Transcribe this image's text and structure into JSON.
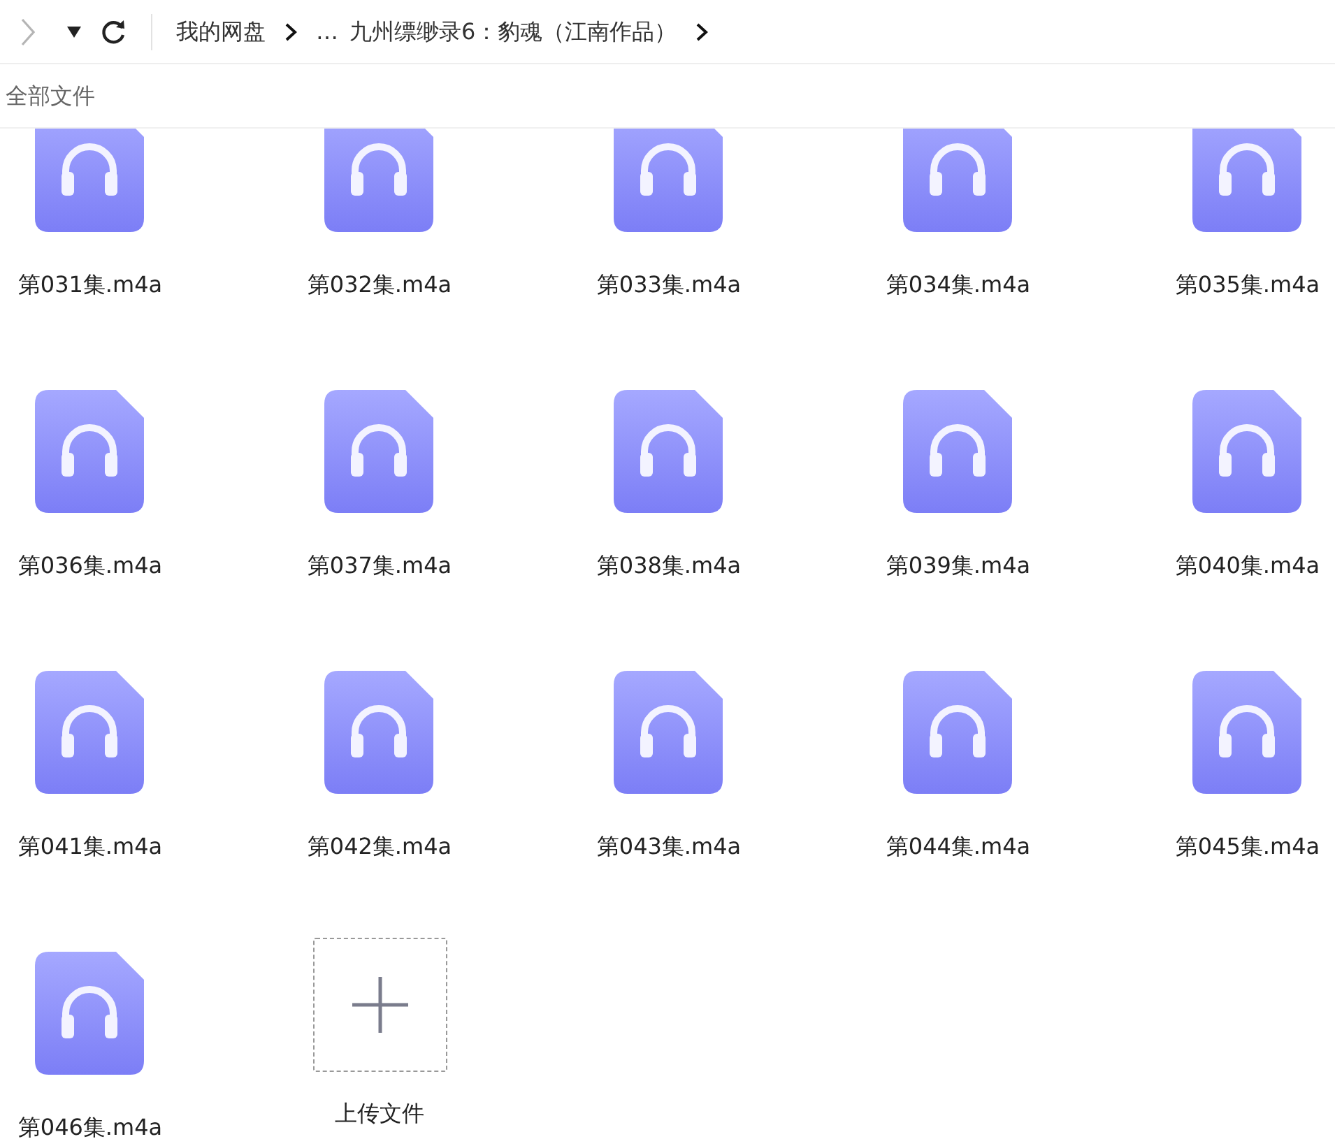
{
  "toolbar": {
    "forward_disabled": true,
    "breadcrumb": [
      {
        "kind": "link",
        "label": "我的网盘"
      },
      {
        "kind": "separator"
      },
      {
        "kind": "link",
        "label": "…"
      },
      {
        "kind": "link",
        "label": "九州缥缈录6：豹魂（江南作品）"
      },
      {
        "kind": "separator"
      }
    ]
  },
  "section_title": "全部文件",
  "files": [
    {
      "kind": "audio",
      "name": "第031集.m4a"
    },
    {
      "kind": "audio",
      "name": "第032集.m4a"
    },
    {
      "kind": "audio",
      "name": "第033集.m4a"
    },
    {
      "kind": "audio",
      "name": "第034集.m4a"
    },
    {
      "kind": "audio",
      "name": "第035集.m4a"
    },
    {
      "kind": "audio",
      "name": "第036集.m4a"
    },
    {
      "kind": "audio",
      "name": "第037集.m4a"
    },
    {
      "kind": "audio",
      "name": "第038集.m4a"
    },
    {
      "kind": "audio",
      "name": "第039集.m4a"
    },
    {
      "kind": "audio",
      "name": "第040集.m4a"
    },
    {
      "kind": "audio",
      "name": "第041集.m4a"
    },
    {
      "kind": "audio",
      "name": "第042集.m4a"
    },
    {
      "kind": "audio",
      "name": "第043集.m4a"
    },
    {
      "kind": "audio",
      "name": "第044集.m4a"
    },
    {
      "kind": "audio",
      "name": "第045集.m4a"
    },
    {
      "kind": "audio",
      "name": "第046集.m4a"
    },
    {
      "kind": "upload",
      "name": "上传文件"
    }
  ]
}
